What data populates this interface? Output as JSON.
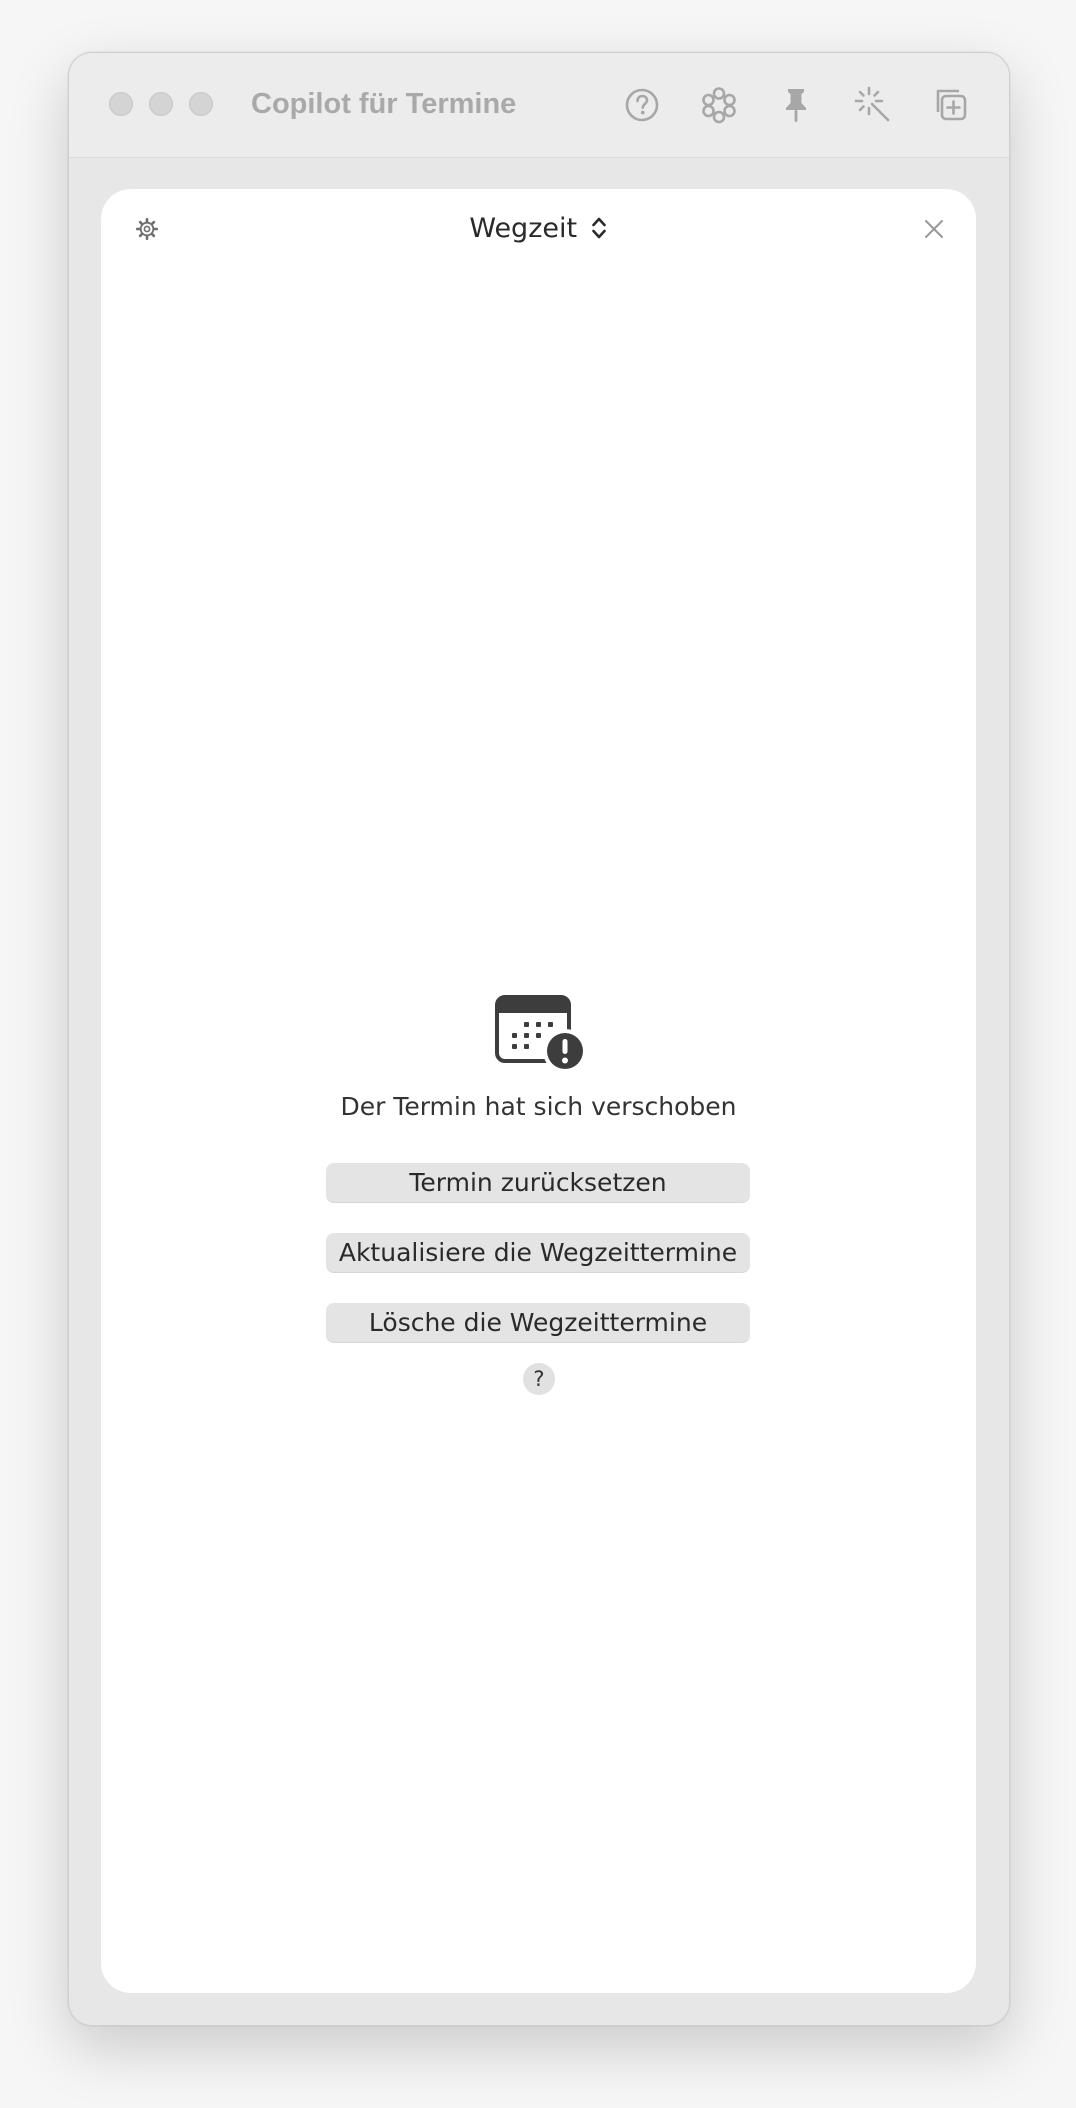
{
  "window": {
    "title": "Copilot für Termine"
  },
  "toolbar": {
    "icons": [
      "help-icon",
      "flower-icon",
      "pin-icon",
      "magic-wand-icon",
      "add-window-icon"
    ]
  },
  "panel": {
    "settings_icon": "gear-icon",
    "mode": "Wegzeit",
    "close_icon": "close-icon"
  },
  "status": {
    "icon": "calendar-alert-icon",
    "message": "Der Termin hat sich verschoben"
  },
  "actions": {
    "reset_label": "Termin zurücksetzen",
    "update_label": "Aktualisiere die Wegzeittermine",
    "delete_label": "Lösche die Wegzeittermine",
    "help_label": "?"
  },
  "colors": {
    "window_bg": "#e7e7e7",
    "panel_bg": "#ffffff",
    "button_bg": "#e4e4e4",
    "title_text": "#a9a9a9",
    "icon_dark": "#3d3d3d"
  }
}
